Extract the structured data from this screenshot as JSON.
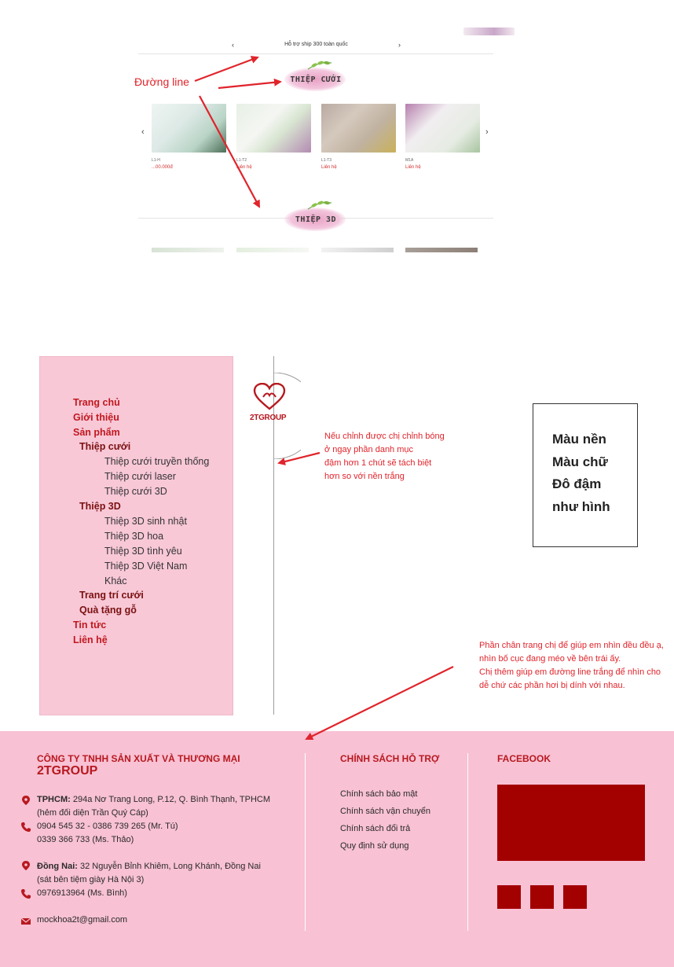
{
  "mockup": {
    "notice": "Hỗ trợ ship 300 toàn quốc",
    "notice_prev": "‹",
    "notice_next": "›",
    "annotation_line": "Đường line",
    "section1_title": "THIỆP CƯỚI",
    "section2_title": "THIỆP 3D",
    "slider_prev": "‹",
    "slider_next": "›",
    "products": [
      {
        "name": "L1-H",
        "price": "...00.000đ"
      },
      {
        "name": "L1-T2",
        "price": "Liên hệ"
      },
      {
        "name": "L1-T3",
        "price": "Liên hệ"
      },
      {
        "name": "M1A",
        "price": "Liên hệ"
      }
    ]
  },
  "menu": {
    "items": [
      {
        "label": "Trang chủ",
        "level": 1
      },
      {
        "label": "Giới thiệu",
        "level": 1
      },
      {
        "label": "Sản phẩm",
        "level": 1
      },
      {
        "label": "Thiệp cưới",
        "level": 2
      },
      {
        "label": "Thiệp cưới truyền thống",
        "level": 3
      },
      {
        "label": "Thiệp cưới laser",
        "level": 3
      },
      {
        "label": "Thiệp cưới 3D",
        "level": 3
      },
      {
        "label": "Thiệp 3D",
        "level": 2
      },
      {
        "label": "Thiệp 3D sinh nhật",
        "level": 3
      },
      {
        "label": "Thiệp 3D hoa",
        "level": 3
      },
      {
        "label": "Thiệp 3D tình yêu",
        "level": 3
      },
      {
        "label": "Thiệp 3D Việt Nam",
        "level": 3
      },
      {
        "label": "Khác",
        "level": 3
      },
      {
        "label": "Trang trí cưới",
        "level": 2
      },
      {
        "label": "Quà tặng gỗ",
        "level": 2
      },
      {
        "label": "Tin tức",
        "level": 1
      },
      {
        "label": "Liên hệ",
        "level": 1
      }
    ]
  },
  "logo": {
    "text": "2TGROUP"
  },
  "notes": {
    "shadow": [
      "Nếu chỉnh được chị chỉnh bóng",
      "ở ngay phần danh mục",
      " đậm hơn 1 chút sẽ tách biệt",
      "hơn so với nền trắng"
    ],
    "box": [
      "Màu nền",
      "Màu chữ",
      "Đô đậm",
      "như hình"
    ],
    "footer": [
      "Phần chân trang chị để giúp em nhìn đều đều ạ,",
      "nhìn bố cục đang méo về bên trái ấy.",
      "Chị thêm giúp em đường line trắng để nhìn cho",
      "dễ chứ các phần hơi bị dính với nhau."
    ]
  },
  "footer": {
    "company_line": "CÔNG TY TNHH SẢN XUẤT VÀ THƯƠNG MẠI",
    "company_name": "2TGROUP",
    "hcm_label": "TPHCM:",
    "hcm_address": " 294a Nơ Trang Long, P.12, Q. Bình Thạnh, TPHCM",
    "hcm_note": "(hẻm đối diện Trần Quý Cáp)",
    "hcm_phone1": "0904 545 32 - 0386 739 265 (Mr. Tú)",
    "hcm_phone2": "0339 366 733 (Ms. Thảo)",
    "dn_label": "Đồng Nai:",
    "dn_address": " 32 Nguyễn Bỉnh Khiêm, Long Khánh, Đồng Nai",
    "dn_note": "(sát bên tiệm giày Hà Nội 3)",
    "dn_phone": "0976913964 (Ms. Bình)",
    "email": "mockhoa2t@gmail.com",
    "policy_title": "CHÍNH SÁCH HỖ TRỢ",
    "policies": [
      "Chính sách bảo mật",
      "Chính sách vận chuyển",
      "Chính sách đổi trả",
      "Quy định sử dụng"
    ],
    "facebook_title": "FACEBOOK"
  },
  "colors": {
    "accent": "#b7191f",
    "footer_bg": "#f8c1d4",
    "menu_bg": "#f8c8d7",
    "annotation": "#e0242b",
    "fb_box": "#a30000"
  }
}
